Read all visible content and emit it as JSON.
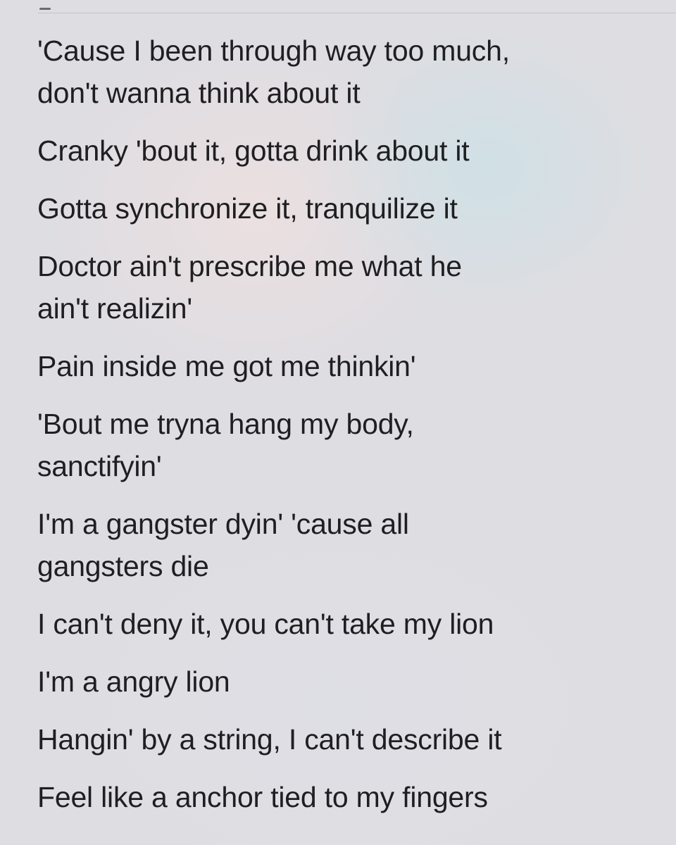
{
  "lyrics": {
    "lines": [
      "'Cause I been through way too much,\ndon't wanna think about it",
      "Cranky 'bout it, gotta drink about it",
      "Gotta synchronize it, tranquilize it",
      "Doctor ain't prescribe me what he\nain't realizin'",
      "Pain inside me got me thinkin'",
      "'Bout me tryna hang my body,\nsanctifyin'",
      "I'm a gangster dyin' 'cause all\ngangsters die",
      "I can't deny it, you can't take my lion",
      "I'm a angry lion",
      "Hangin' by a string, I can't describe it",
      "Feel like a anchor tied to my fingers"
    ]
  }
}
